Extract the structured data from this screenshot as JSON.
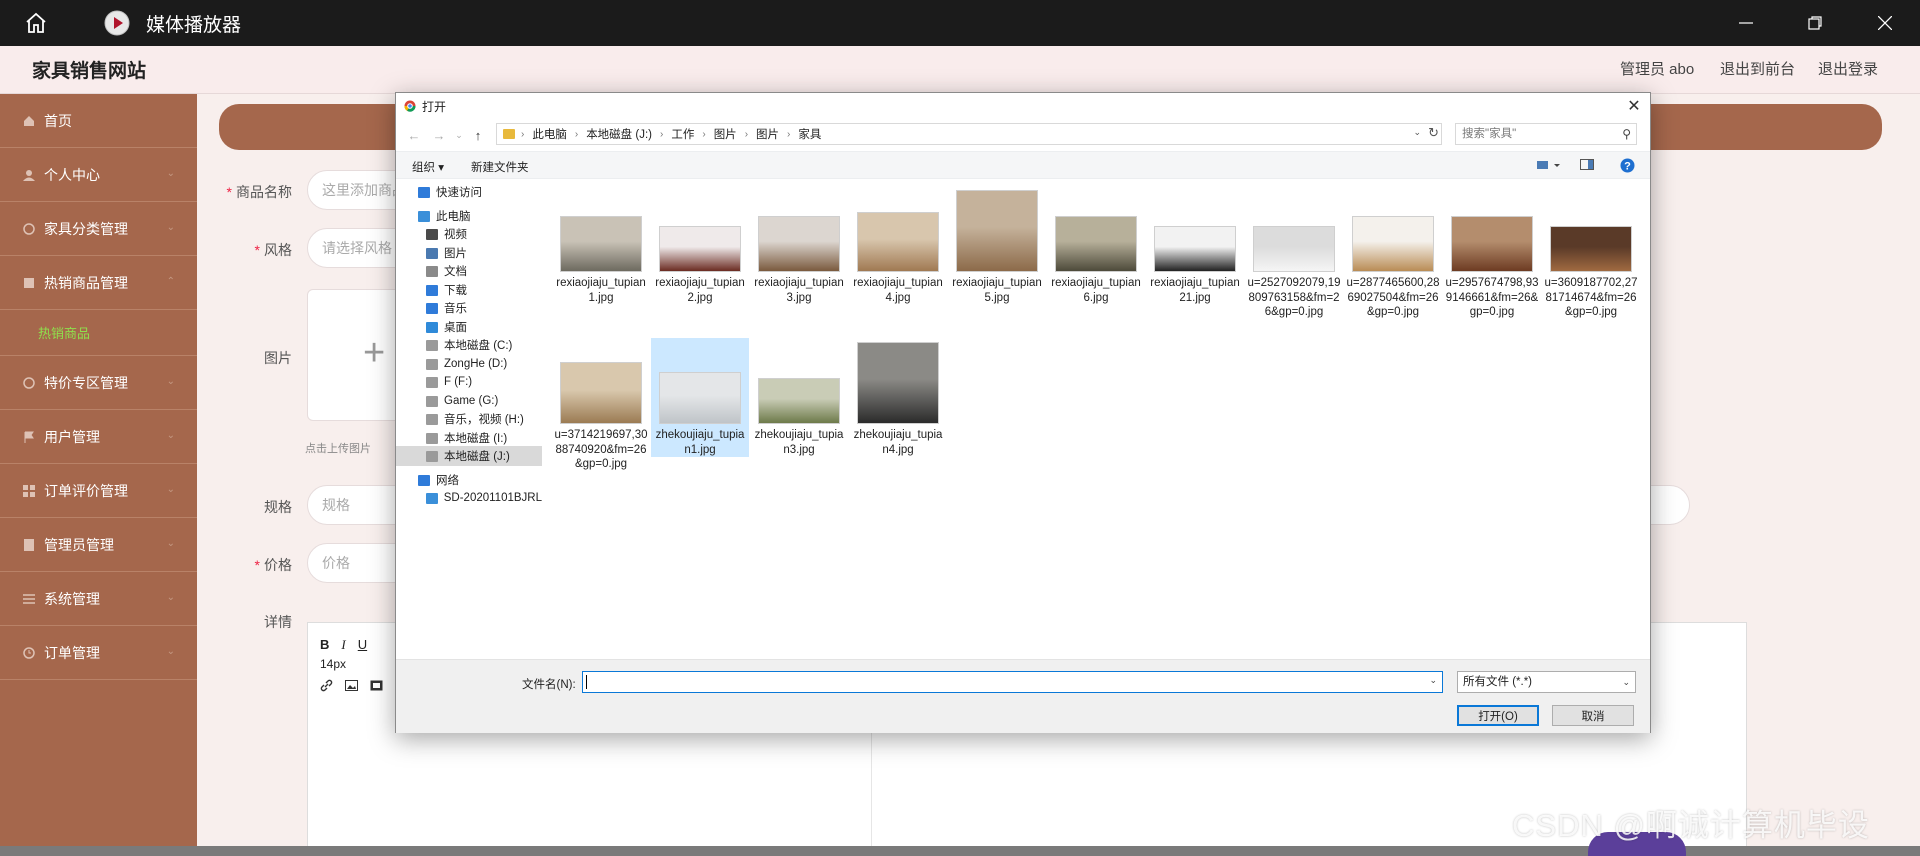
{
  "player": {
    "title": "媒体播放器",
    "icons": {
      "home": "home-icon",
      "app": "play-icon",
      "minimize": "minimize-icon",
      "maximize": "restore-icon",
      "close": "close-icon"
    }
  },
  "site": {
    "title": "家具销售网站",
    "admin_label": "管理员 abo",
    "to_front_label": "退出到前台",
    "logout_label": "退出登录",
    "accent_color": "#a5674c"
  },
  "sidebar": {
    "items": [
      {
        "label": "首页",
        "icon": "home-icon"
      },
      {
        "label": "个人中心",
        "icon": "user-icon"
      },
      {
        "label": "家具分类管理",
        "icon": "category-icon"
      },
      {
        "label": "热销商品管理",
        "icon": "list-icon"
      },
      {
        "label": "特价专区管理",
        "icon": "tag-icon"
      },
      {
        "label": "用户管理",
        "icon": "flag-icon"
      },
      {
        "label": "订单评价管理",
        "icon": "grid-icon"
      },
      {
        "label": "管理员管理",
        "icon": "book-icon"
      },
      {
        "label": "系统管理",
        "icon": "menu-icon"
      },
      {
        "label": "订单管理",
        "icon": "clock-icon"
      }
    ],
    "submenu_label": "热销商品"
  },
  "form": {
    "name_label": "商品名称",
    "name_value": "这里添加商品",
    "style_label": "风格",
    "style_placeholder": "请选择风格",
    "image_label": "图片",
    "upload_tip": "点击上传图片",
    "spec_label": "规格",
    "spec_placeholder": "规格",
    "price_label": "价格",
    "price_placeholder": "价格",
    "detail_label": "详情",
    "editor_font_size": "14px"
  },
  "dialog": {
    "title": "打开",
    "breadcrumbs": [
      "此电脑",
      "本地磁盘 (J:)",
      "工作",
      "图片",
      "图片",
      "家具"
    ],
    "search_placeholder": "搜索\"家具\"",
    "toolbar": {
      "organize": "组织 ▾",
      "new_folder": "新建文件夹"
    },
    "tree": [
      {
        "label": "快速访问",
        "indent": 0,
        "icon": "star-icon"
      },
      {
        "label": "此电脑",
        "indent": 0,
        "icon": "computer-icon"
      },
      {
        "label": "视频",
        "indent": 1,
        "icon": "video-folder-icon"
      },
      {
        "label": "图片",
        "indent": 1,
        "icon": "picture-folder-icon"
      },
      {
        "label": "文档",
        "indent": 1,
        "icon": "document-folder-icon"
      },
      {
        "label": "下载",
        "indent": 1,
        "icon": "download-folder-icon"
      },
      {
        "label": "音乐",
        "indent": 1,
        "icon": "music-folder-icon"
      },
      {
        "label": "桌面",
        "indent": 1,
        "icon": "desktop-folder-icon"
      },
      {
        "label": "本地磁盘 (C:)",
        "indent": 1,
        "icon": "drive-icon"
      },
      {
        "label": "ZongHe (D:)",
        "indent": 1,
        "icon": "drive-icon"
      },
      {
        "label": "F (F:)",
        "indent": 1,
        "icon": "drive-icon"
      },
      {
        "label": "Game (G:)",
        "indent": 1,
        "icon": "drive-icon"
      },
      {
        "label": "音乐，视频 (H:)",
        "indent": 1,
        "icon": "drive-icon"
      },
      {
        "label": "本地磁盘 (I:)",
        "indent": 1,
        "icon": "drive-icon"
      },
      {
        "label": "本地磁盘 (J:)",
        "indent": 1,
        "icon": "drive-icon",
        "selected": true
      },
      {
        "label": "网络",
        "indent": 0,
        "icon": "network-icon"
      },
      {
        "label": "SD-20201101BJRL",
        "indent": 1,
        "icon": "network-computer-icon"
      }
    ],
    "files": [
      {
        "name": "rexiaojiaju_tupian1.jpg",
        "colors": [
          "#c9c2b6",
          "#6d6a5f"
        ]
      },
      {
        "name": "rexiaojiaju_tupian2.jpg",
        "colors": [
          "#efeaea",
          "#6b2b22"
        ]
      },
      {
        "name": "rexiaojiaju_tupian3.jpg",
        "colors": [
          "#dcd6d0",
          "#7a5a3e"
        ]
      },
      {
        "name": "rexiaojiaju_tupian4.jpg",
        "colors": [
          "#d8c6ad",
          "#a07952"
        ]
      },
      {
        "name": "rexiaojiaju_tupian5.jpg",
        "colors": [
          "#c5b29b",
          "#8c6a49"
        ]
      },
      {
        "name": "rexiaojiaju_tupian6.jpg",
        "colors": [
          "#b7b09a",
          "#4d4a3a"
        ]
      },
      {
        "name": "rexiaojiaju_tupian21.jpg",
        "colors": [
          "#f2f2f2",
          "#222222"
        ]
      },
      {
        "name": "u=2527092079,19809763158&fm=26&gp=0.jpg",
        "colors": [
          "#dcdcdc",
          "#f5f5f5"
        ]
      },
      {
        "name": "u=2877465600,2869027504&fm=26&gp=0.jpg",
        "colors": [
          "#f4f1ec",
          "#b98c55"
        ]
      },
      {
        "name": "u=2957674798,939146661&fm=26&gp=0.jpg",
        "colors": [
          "#b48d6d",
          "#6d3b22"
        ]
      },
      {
        "name": "u=3609187702,2781714674&fm=26&gp=0.jpg",
        "colors": [
          "#5a3a28",
          "#a06a40"
        ]
      },
      {
        "name": "u=3714219697,3088740920&fm=26&gp=0.jpg",
        "colors": [
          "#d9c8ad",
          "#9b7b53"
        ]
      },
      {
        "name": "zhekoujiaju_tupian1.jpg",
        "colors": [
          "#e4e6e8",
          "#bfc4c8"
        ],
        "selected": true
      },
      {
        "name": "zhekoujiaju_tupian3.jpg",
        "colors": [
          "#c9ccb6",
          "#6d7a4a"
        ]
      },
      {
        "name": "zhekoujiaju_tupian4.jpg",
        "colors": [
          "#8b8a86",
          "#2b2b2b"
        ]
      }
    ],
    "filename_label": "文件名(N):",
    "filename_value": "",
    "filter_label": "所有文件 (*.*)",
    "open_label": "打开(O)",
    "cancel_label": "取消"
  },
  "watermark": "CSDN @啊诚计算机毕设"
}
